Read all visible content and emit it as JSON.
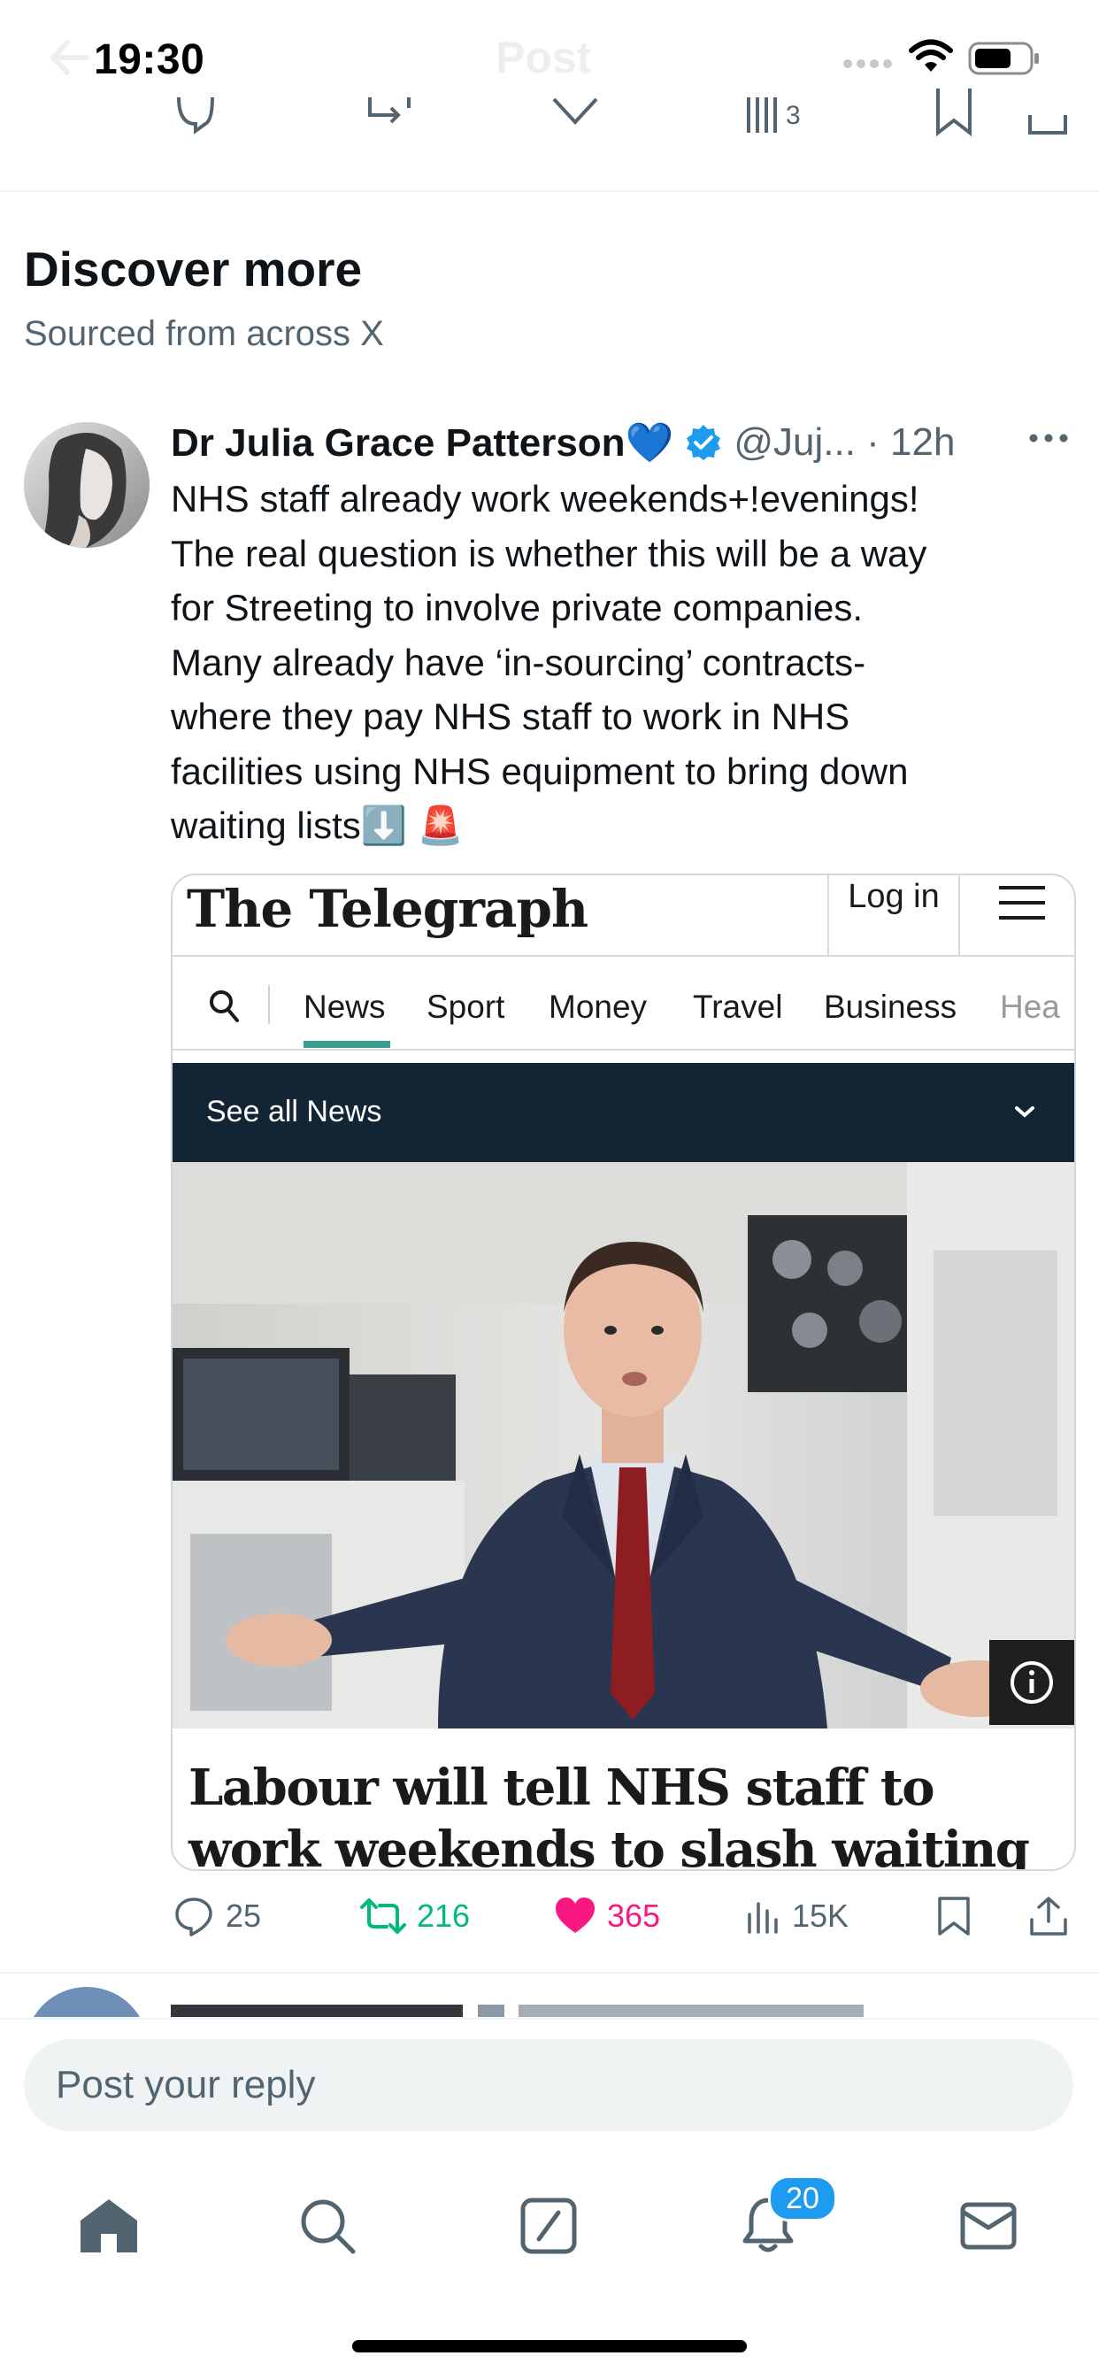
{
  "status_bar": {
    "time": "19:30"
  },
  "nav": {
    "title": "Post"
  },
  "section": {
    "title": "Discover more",
    "subtitle": "Sourced from across X"
  },
  "tweet": {
    "author_name": "Dr Julia Grace Patterson💙",
    "handle_time": "@Juj... · 12h",
    "text_lines": [
      "NHS staff already work weekends+!evenings!",
      "The real question is whether this will be a way",
      "for Streeting to involve private companies.",
      "Many already have ‘in-sourcing’ contracts-",
      "where they pay NHS staff to work in NHS",
      "facilities using NHS equipment to bring down",
      "waiting lists⬇️ 🚨"
    ],
    "stats": {
      "replies": "25",
      "reposts": "216",
      "likes": "365",
      "views": "15K"
    },
    "colors": {
      "repost": "#00ba7c",
      "like": "#f91880",
      "verified": "#1d9bf0"
    }
  },
  "card": {
    "logo": "The Telegraph",
    "login": "Log in",
    "nav_items": [
      "News",
      "Sport",
      "Money",
      "Travel",
      "Business",
      "Hea"
    ],
    "see_all": "See all News",
    "headline": "Labour will tell NHS staff to work weekends to slash waiting lists"
  },
  "reply": {
    "placeholder": "Post your reply"
  },
  "tabbar": {
    "notifications_badge": "20"
  }
}
